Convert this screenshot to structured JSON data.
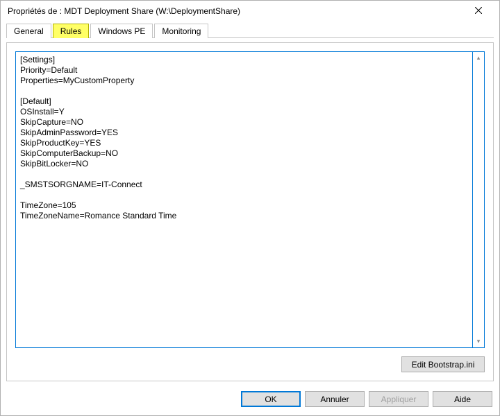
{
  "titlebar": {
    "title": "Propriétés de : MDT Deployment Share (W:\\DeploymentShare)"
  },
  "tabs": {
    "general": "General",
    "rules": "Rules",
    "windows_pe": "Windows PE",
    "monitoring": "Monitoring"
  },
  "editor": {
    "content": "[Settings]\nPriority=Default\nProperties=MyCustomProperty\n\n[Default]\nOSInstall=Y\nSkipCapture=NO\nSkipAdminPassword=YES\nSkipProductKey=YES\nSkipComputerBackup=NO\nSkipBitLocker=NO\n\n_SMSTSORGNAME=IT-Connect\n\nTimeZone=105\nTimeZoneName=Romance Standard Time"
  },
  "panel_buttons": {
    "edit_bootstrap": "Edit Bootstrap.ini"
  },
  "dialog_buttons": {
    "ok": "OK",
    "cancel": "Annuler",
    "apply": "Appliquer",
    "help": "Aide"
  }
}
